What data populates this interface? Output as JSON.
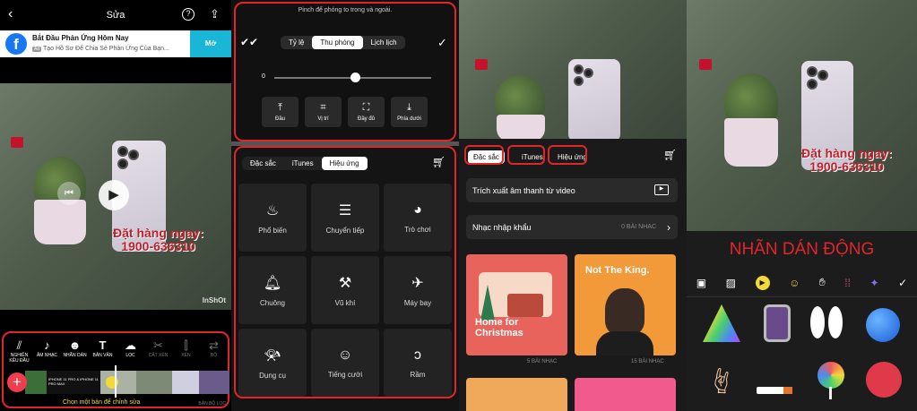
{
  "editor": {
    "title": "Sửa",
    "back_icon": "back-chevron-icon",
    "help_icon": "question-circle-icon",
    "share_icon": "share-icon",
    "ad": {
      "title": "Bắt Đầu Phản Ứng Hôm Nay",
      "subtitle": "Tạo Hồ Sơ Để Chia Sẻ Phản Ứng Của Bạn...",
      "tag": "Ad",
      "cta": "Mở"
    },
    "overlay_text_line1": "Đặt hàng ngay:",
    "overlay_text_line2": "1900-636310",
    "watermark": "InShOt",
    "tools": [
      {
        "icon": "canvas-icon",
        "label": "NGHIÊN KÊU ĐẦU"
      },
      {
        "icon": "music-note-icon",
        "label": "ÂM NHẠC"
      },
      {
        "icon": "smiley-icon",
        "label": "NHÃN DÁN"
      },
      {
        "icon": "text-T-icon",
        "label": "BẢN VĂN"
      },
      {
        "icon": "filter-icon",
        "label": "LỌC"
      },
      {
        "icon": "scissors-icon",
        "label": "CẮT XÉN"
      },
      {
        "icon": "split-icon",
        "label": "XÉN"
      },
      {
        "icon": "more-icon",
        "label": "BỘ"
      }
    ],
    "timeline_hint": "Chọn một bản để chỉnh sửa",
    "timeline_right": "BẢN BỘ LỌC",
    "timeline_clip_caption": "IPHONE 11 PRO & IPHONE 11 PRO MAX"
  },
  "zoom_panel": {
    "hint": "Pinch để phóng to trong và ngoài.",
    "tabs": [
      "Tỷ lệ",
      "Thu phóng",
      "Lịch lịch"
    ],
    "active_tab": "Thu phóng",
    "slider_value": "0",
    "buttons": [
      {
        "icon": "align-top-icon",
        "label": "Đầu"
      },
      {
        "icon": "position-center-icon",
        "label": "Vị trí"
      },
      {
        "icon": "fullscreen-icon",
        "label": "Đầy đủ"
      },
      {
        "icon": "align-bottom-icon",
        "label": "Phía dưới"
      }
    ]
  },
  "music_effects": {
    "tabs": [
      "Đặc sắc",
      "iTunes",
      "Hiệu ứng"
    ],
    "active_tab": "Hiệu ứng",
    "cart_icon": "cart-icon",
    "effects": [
      {
        "icon": "flame-icon",
        "label": "Phổ biến"
      },
      {
        "icon": "speed-lines-icon",
        "label": "Chuyển tiếp"
      },
      {
        "icon": "pacman-icon",
        "label": "Trò chơi"
      },
      {
        "icon": "bell-icon",
        "label": "Chuông"
      },
      {
        "icon": "gavel-icon",
        "label": "Vũ khí"
      },
      {
        "icon": "airplane-icon",
        "label": "Máy bay"
      },
      {
        "icon": "horn-icon",
        "label": "Dụng cụ"
      },
      {
        "icon": "laugh-icon",
        "label": "Tiếng cười"
      },
      {
        "icon": "ear-icon",
        "label": "Rầm"
      }
    ]
  },
  "music_featured": {
    "tabs": [
      "Đặc sắc",
      "iTunes",
      "Hiệu ứng"
    ],
    "active_tab": "Đặc sắc",
    "extract_label": "Trích xuất âm thanh từ video",
    "import_label": "Nhạc nhập khẩu",
    "import_count": "0 BÀI NHẠC",
    "covers": [
      {
        "title": "Home for Christmas",
        "count": "5 BÀI NHẠC",
        "color": "#e8635c"
      },
      {
        "title": "Not The King.",
        "count": "15 BÀI NHẠC",
        "color": "#f29a3a"
      }
    ]
  },
  "stickers": {
    "heading": "NHÃN DÁN ĐỘNG",
    "toolbar_icons": [
      "bag-icon",
      "image-icon",
      "play-circle-icon",
      "emoji-icon",
      "hand-icon",
      "grid-icon",
      "sparkle-icon",
      "check-icon"
    ],
    "items": [
      "party-hat-icon",
      "phone-face-icon",
      "bunny-ears-icon",
      "planet-icon",
      "rock-hand-icon",
      "cigarette-icon",
      "lollipop-icon",
      "flower-icon"
    ]
  },
  "colors": {
    "accent_red": "#e0262b",
    "overlay_red": "#c0202a",
    "add_button": "#f23d4f",
    "ad_cta": "#19b6d8"
  }
}
